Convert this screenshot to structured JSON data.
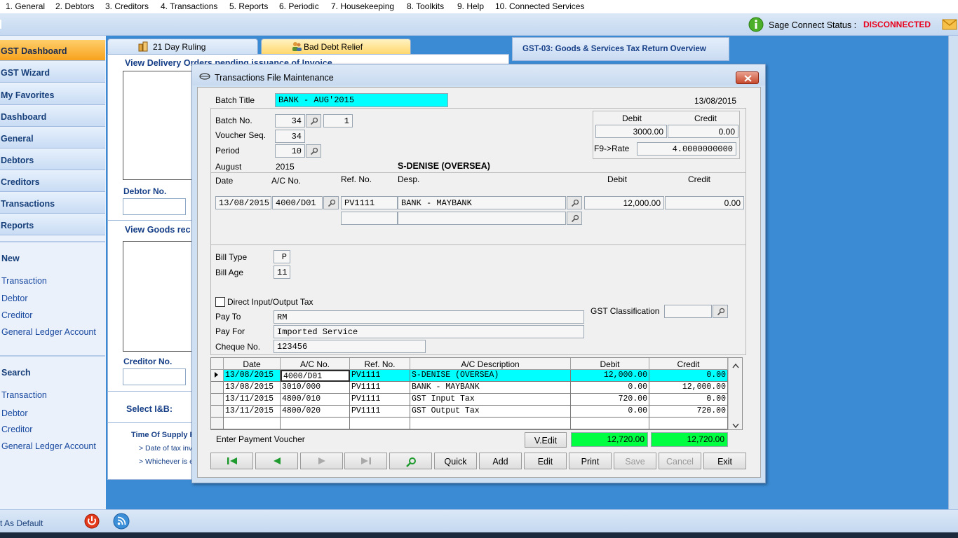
{
  "menu": [
    "1. General",
    "2. Debtors",
    "3. Creditors",
    "4. Transactions",
    "5. Reports",
    "6. Periodic",
    "7. Housekeeping",
    "8. Toolkits",
    "9. Help",
    "10. Connected Services"
  ],
  "status": {
    "label": "Sage Connect Status :",
    "value": "DISCONNECTED",
    "value_color": "#e8001c"
  },
  "sidebar": {
    "buttons": [
      "GST Dashboard",
      "GST Wizard",
      "My Favorites",
      "Dashboard",
      "General",
      "Debtors",
      "Creditors",
      "Transactions",
      "Reports"
    ],
    "new_heading": "New",
    "new_links": [
      "Transaction",
      "Debtor",
      "Creditor",
      "General Ledger Account"
    ],
    "search_heading": "Search",
    "search_links": [
      "Transaction",
      "Debtor",
      "Creditor",
      "General Ledger Account"
    ],
    "set_default": "t As Default"
  },
  "background": {
    "tab1": "21 Day Ruling",
    "tab2": "Bad Debt Relief",
    "tab3": "GST-03: Goods & Services Tax Return Overview",
    "heading1": "View Delivery Orders pending issuance of Invoice",
    "debtor_no": "Debtor No.",
    "heading2": "View Goods rec",
    "creditor_no": "Creditor No.",
    "select_ib": "Select I&B:",
    "supply_title": "Time Of Supply R",
    "supply_line1": "> Date of tax invo",
    "supply_line2": "> Whichever is e"
  },
  "dialog": {
    "title": "Transactions File Maintenance",
    "batch_title_label": "Batch Title",
    "batch_title_value": "BANK - AUG'2015",
    "date": "13/08/2015",
    "batch_no_label": "Batch No.",
    "batch_no_value": "34",
    "batch_no_seq": "1",
    "voucher_seq_label": "Voucher Seq.",
    "voucher_seq_value": "34",
    "period_label": "Period",
    "period_value": "10",
    "summary": {
      "debit_label": "Debit",
      "credit_label": "Credit",
      "debit": "3000.00",
      "credit": "0.00",
      "rate_label": "F9->Rate",
      "rate": "4.0000000000"
    },
    "month": "August",
    "year": "2015",
    "account_name": "S-DENISE (OVERSEA)",
    "entry_headers": {
      "date": "Date",
      "ac": "A/C No.",
      "ref": "Ref. No.",
      "desp": "Desp.",
      "debit": "Debit",
      "credit": "Credit"
    },
    "entry": {
      "date": "13/08/2015",
      "ac": "4000/D01",
      "ref": "PV1111",
      "desp": "BANK - MAYBANK",
      "debit": "12,000.00",
      "credit": "0.00"
    },
    "bill_type_label": "Bill Type",
    "bill_type_value": "P",
    "bill_age_label": "Bill Age",
    "bill_age_value": "11",
    "direct_tax_label": "Direct Input/Output Tax",
    "gst_class_label": "GST Classification",
    "pay_to_label": "Pay To",
    "pay_to_value": "RM",
    "pay_for_label": "Pay For",
    "pay_for_value": "Imported Service",
    "cheque_label": "Cheque No.",
    "cheque_value": "123456",
    "grid": {
      "headers": [
        "Date",
        "A/C No.",
        "Ref. No.",
        "A/C Description",
        "Debit",
        "Credit"
      ],
      "rows": [
        [
          "13/08/2015",
          "4000/D01",
          "PV1111",
          "S-DENISE (OVERSEA)",
          "12,000.00",
          "0.00"
        ],
        [
          "13/08/2015",
          "3010/000",
          "PV1111",
          "BANK - MAYBANK",
          "0.00",
          "12,000.00"
        ],
        [
          "13/11/2015",
          "4800/010",
          "PV1111",
          "GST Input Tax",
          "720.00",
          "0.00"
        ],
        [
          "13/11/2015",
          "4800/020",
          "PV1111",
          "GST Output Tax",
          "0.00",
          "720.00"
        ]
      ]
    },
    "status_text": "Enter Payment Voucher",
    "vedit": "V.Edit",
    "total_debit": "12,720.00",
    "total_credit": "12,720.00",
    "buttons": {
      "quick": "Quick",
      "add": "Add",
      "edit": "Edit",
      "print": "Print",
      "save": "Save",
      "cancel": "Cancel",
      "exit": "Exit"
    }
  }
}
